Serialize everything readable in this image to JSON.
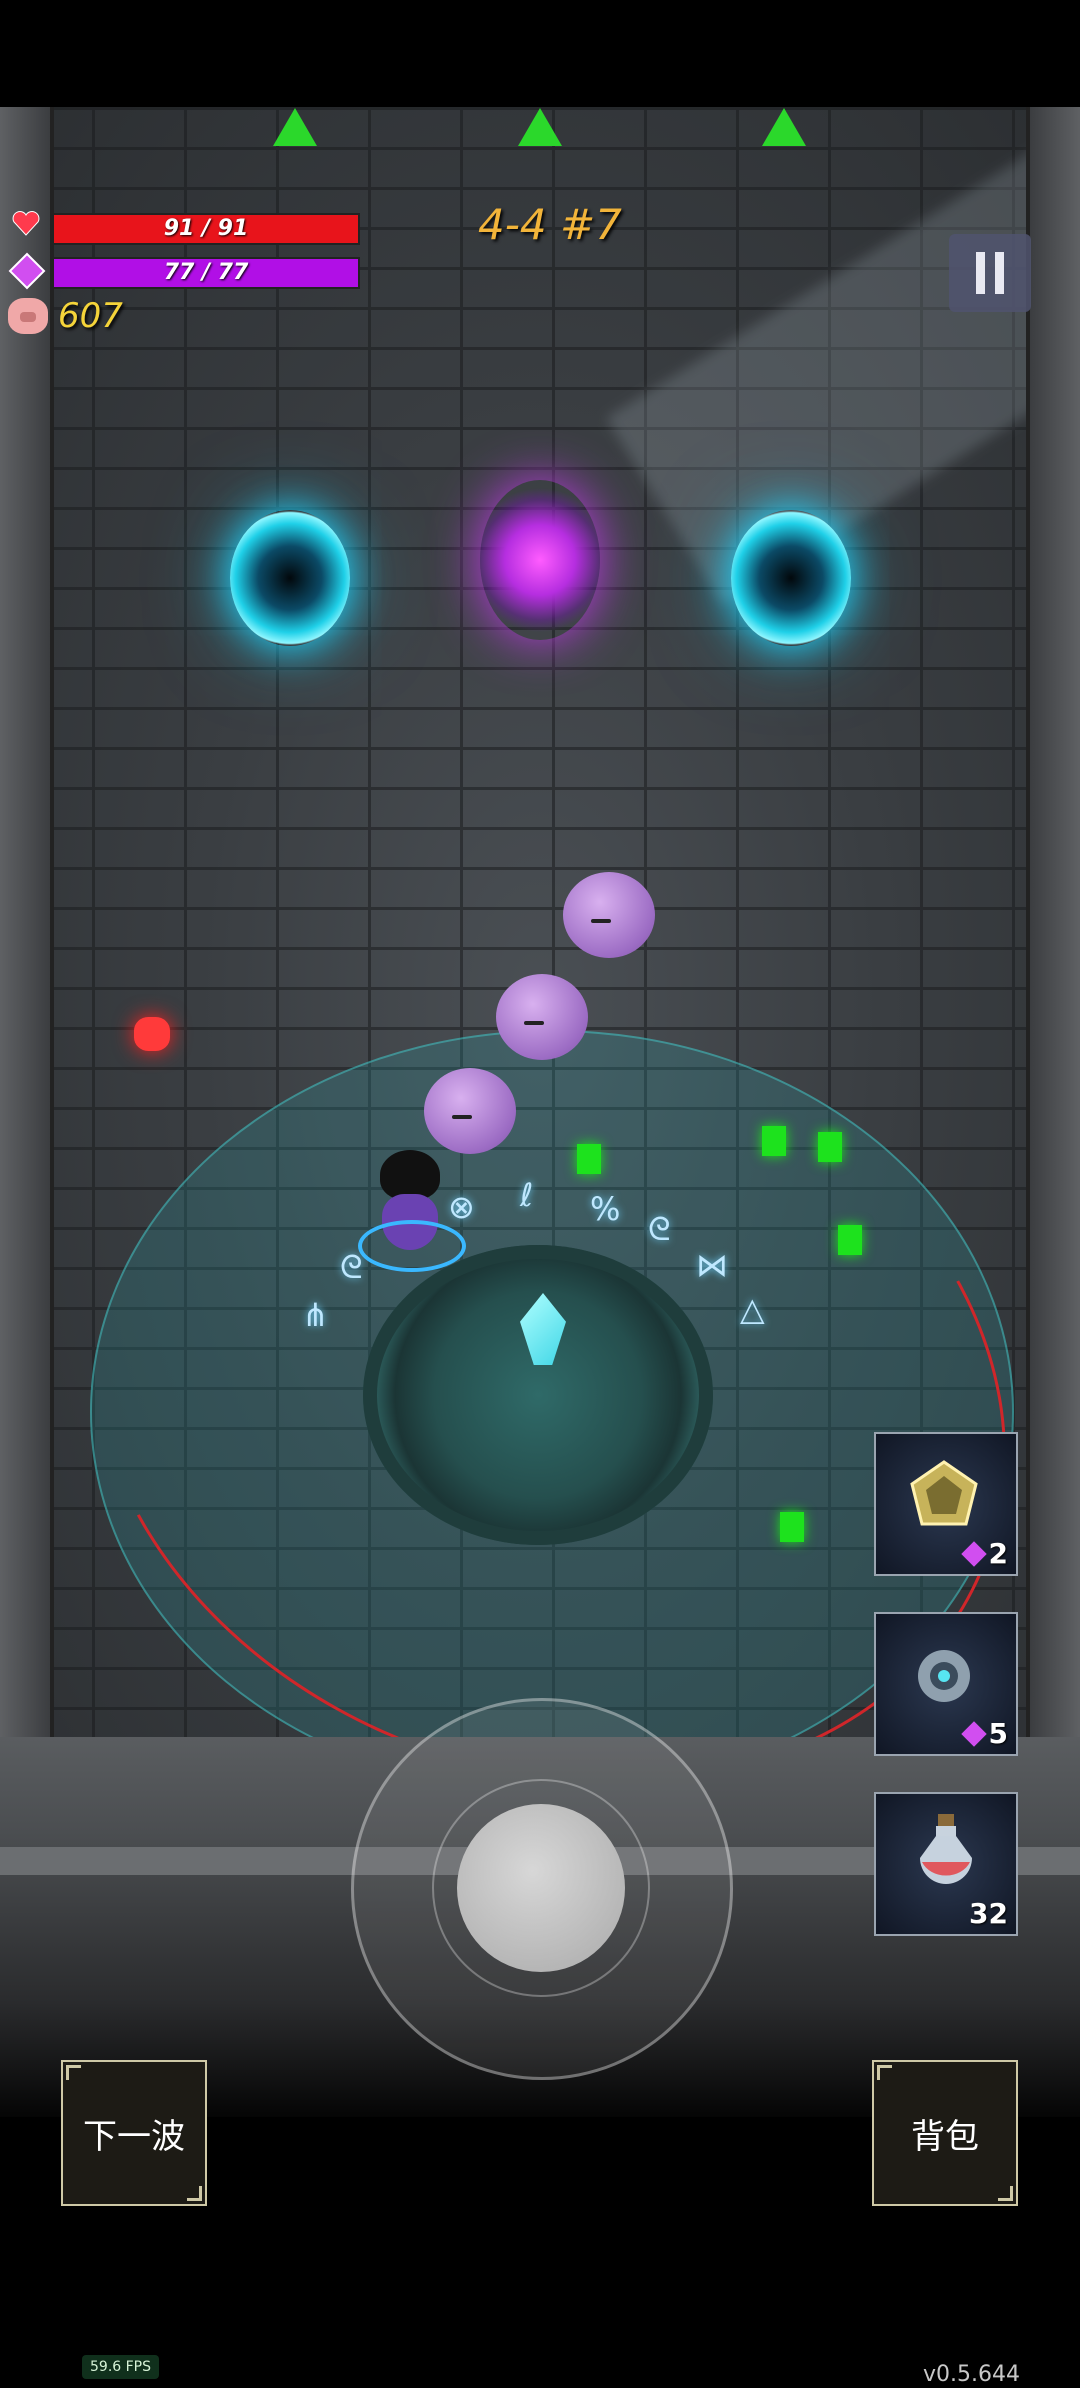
{
  "hud": {
    "hp": "91 / 91",
    "mp": "77 / 77",
    "gold": "607",
    "wave": "4-4 #7",
    "hp_color": "#e8141b",
    "mp_color": "#b10fe6"
  },
  "skills": [
    {
      "icon": "crystal-shield-icon",
      "cost": "2"
    },
    {
      "icon": "orb-icon",
      "cost": "5"
    },
    {
      "icon": "potion-icon",
      "count": "32"
    }
  ],
  "buttons": {
    "next_wave": "下一波",
    "backpack": "背包"
  },
  "status": {
    "fps": "59.6 FPS",
    "version": "v0.5.644"
  }
}
